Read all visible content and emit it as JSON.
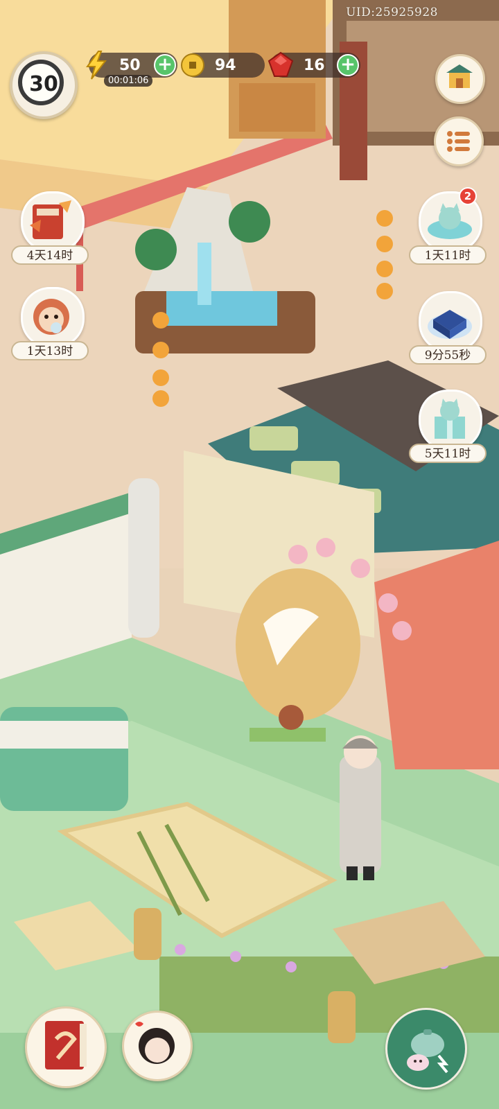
{
  "hud": {
    "uid": "UID:25925928",
    "level": "30",
    "energy": {
      "value": "50",
      "timer": "00:01:06"
    },
    "coins": {
      "value": "94"
    },
    "gems": {
      "value": "16"
    },
    "plus_symbol": "+"
  },
  "left_events": [
    {
      "name": "book-event",
      "timer": "4天14时"
    },
    {
      "name": "monkey-event",
      "timer": "1天13时"
    }
  ],
  "right_events": [
    {
      "name": "spa-event",
      "timer": "1天11时",
      "badge": "2"
    },
    {
      "name": "blue-gift-event",
      "timer": "9分55秒"
    },
    {
      "name": "cat-giftbox-event",
      "timer": "5天11时"
    }
  ],
  "bottom_buttons": {
    "left": "red-book-icon",
    "middle": "character-portrait-icon",
    "right": "teapot-rabbit-icon"
  },
  "icons": {
    "energy": "lightning-icon",
    "coin": "coin-icon",
    "gem": "red-gem-icon",
    "shop": "shop-building-icon",
    "menu": "list-menu-icon"
  },
  "colors": {
    "accent_green": "#58c46a",
    "badge_red": "#e64236",
    "hud_dark": "#3c2d28"
  }
}
